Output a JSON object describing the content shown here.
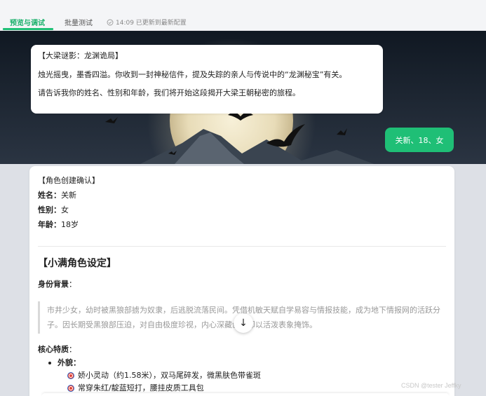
{
  "tabs": [
    {
      "label": "预览与调试",
      "active": true
    },
    {
      "label": "批量测试",
      "active": false
    }
  ],
  "status": {
    "text": "14:09 已更新到最新配置",
    "icon": "check-circle-icon"
  },
  "messages": {
    "bot_intro": {
      "title": "【大梁谜影：龙渊诡局】",
      "paragraph1": "烛光摇曳，墨香四溢。你收到一封神秘信件，提及失踪的亲人与传说中的“龙渊秘宝”有关。",
      "paragraph2": "请告诉我你的姓名、性别和年龄，我们将开始这段揭开大梁王朝秘密的旅程。"
    },
    "user_reply": "关新、18、女",
    "bot_confirm": {
      "title": "【角色创建确认】",
      "fields": [
        {
          "label": "姓名",
          "value": "关新"
        },
        {
          "label": "性别",
          "value": "女"
        },
        {
          "label": "年龄",
          "value": "18岁"
        }
      ],
      "section_heading": "【小满角色设定】",
      "background_label": "身份背景",
      "background_text": "市井少女，幼时被黑狼部掳为奴隶，后逃脱流落民间。凭借机敏天赋自学易容与情报技能，成为地下情报网的活跃分子。因长期受黑狼部压迫，对自由极度珍视，内心深藏创伤却以活泼表象掩饰。",
      "traits_label": "核心特质",
      "traits": [
        {
          "label": "外貌",
          "items": [
            "娇小灵动（约1.58米），双马尾碎发，微黑肤色带雀斑",
            "常穿朱红/靛蓝短打，腰挂皮质工具包"
          ]
        }
      ]
    }
  },
  "scroll_button": {
    "icon": "arrow-down-icon"
  },
  "watermark": "CSDN @tester Jeffky",
  "colors": {
    "accent": "#1fbf76",
    "user_bubble": "#1fbf76"
  }
}
